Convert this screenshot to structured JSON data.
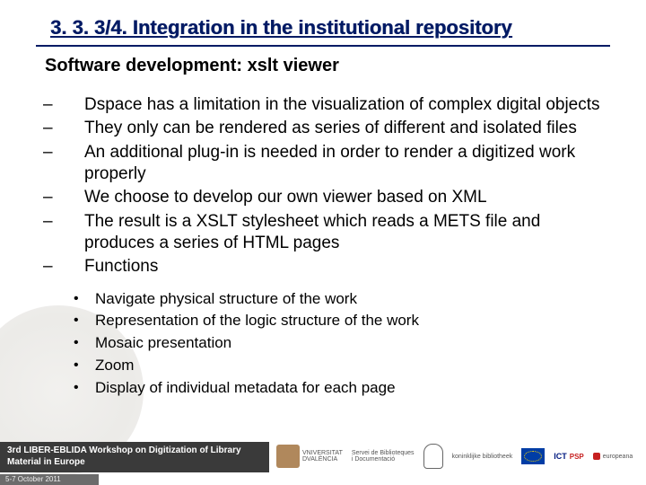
{
  "title": "3. 3. 3/4. Integration in the institutional repository",
  "subtitle": "Software development: xslt viewer",
  "bullets": [
    "Dspace has a limitation in the visualization of complex digital objects",
    "They only can be rendered as series of different and isolated files",
    "An additional plug-in is needed in order to render a digitized work properly",
    "We choose to develop our own viewer based on XML",
    "The result is a XSLT stylesheet which reads a METS file and produces a series of HTML pages",
    "Functions"
  ],
  "sub_bullets": [
    "Navigate physical structure of the work",
    "Representation of the logic structure of the work",
    "Mosaic presentation",
    "Zoom",
    "Display of individual metadata for each page"
  ],
  "footer": {
    "event": "3rd LIBER-EBLIDA Workshop on Digitization of Library Material in Europe",
    "date": "5-7 October 2011",
    "uv_name": "VNIVERSITAT",
    "uv_sub": "DVALÈNCIA",
    "sbd_top": "Servei de Biblioteques",
    "sbd_bot": "i Documentació",
    "kb": "koninklijke bibliotheek",
    "ict_label": "ICT",
    "ict_sub": "PSP",
    "europeana": "europeana"
  }
}
